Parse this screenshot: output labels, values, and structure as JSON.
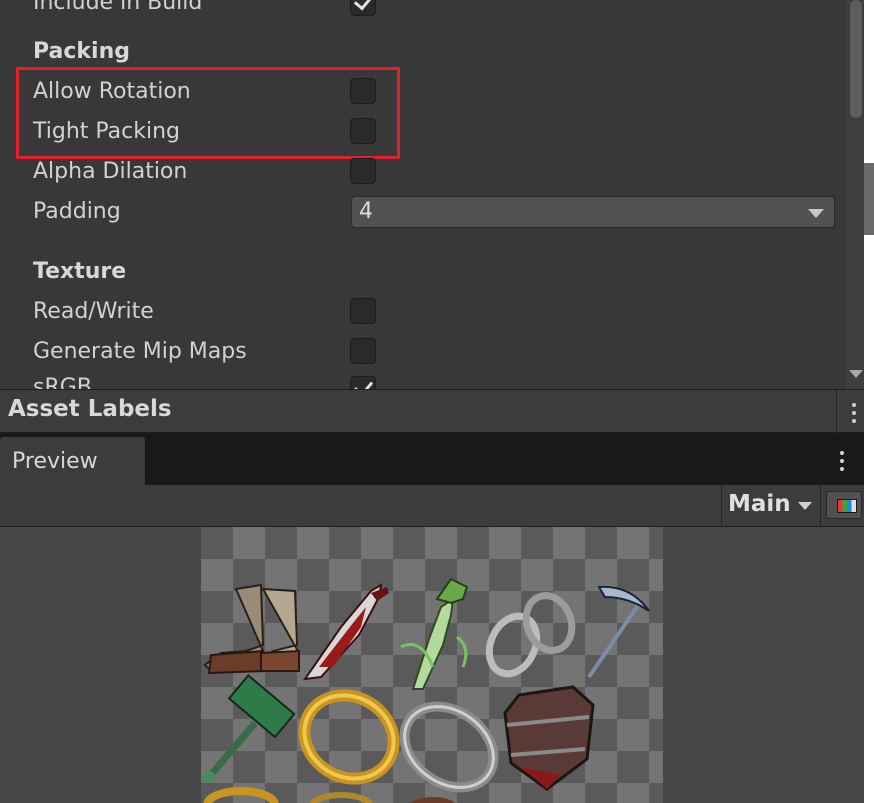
{
  "inspector": {
    "include_in_build_label": "Include in Build",
    "packing_header": "Packing",
    "allow_rotation_label": "Allow Rotation",
    "tight_packing_label": "Tight Packing",
    "alpha_dilation_label": "Alpha Dilation",
    "padding_label": "Padding",
    "padding_value": "4",
    "texture_header": "Texture",
    "read_write_label": "Read/Write",
    "generate_mip_maps_label": "Generate Mip Maps",
    "srgb_label": "sRGB",
    "include_in_build_checked": true,
    "allow_rotation_checked": false,
    "tight_packing_checked": false,
    "alpha_dilation_checked": false,
    "read_write_checked": false,
    "generate_mip_maps_checked": false,
    "srgb_checked": true
  },
  "asset_labels": {
    "title": "Asset Labels"
  },
  "preview": {
    "tab_label": "Preview",
    "channel_value": "Main",
    "channel_icon": "rgb-channels-icon"
  },
  "colors": {
    "highlight": "#e0202a",
    "background": "#383838"
  }
}
